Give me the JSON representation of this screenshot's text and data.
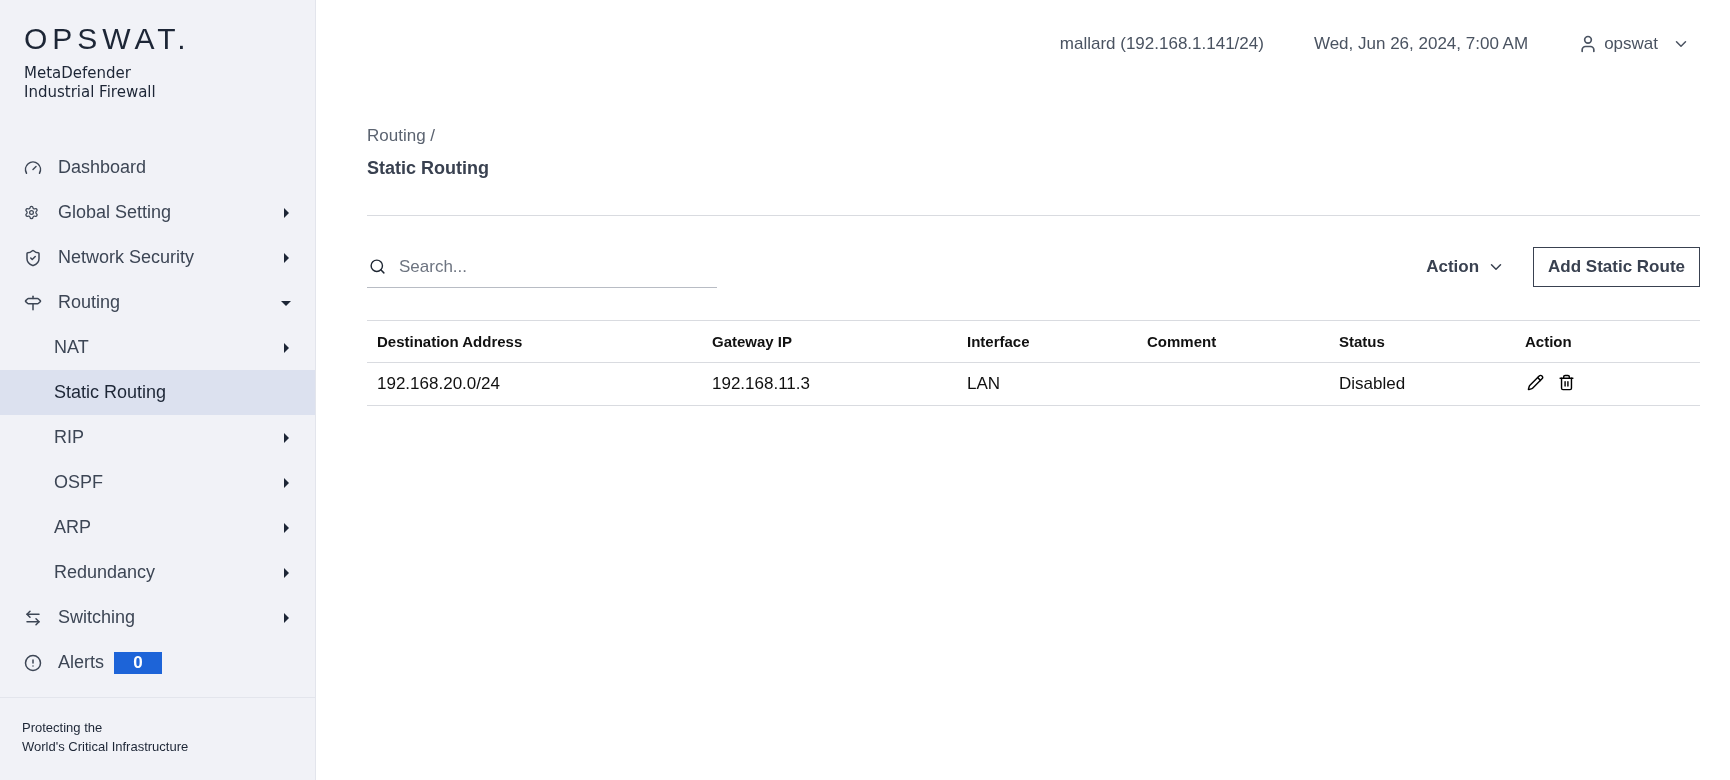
{
  "brand": {
    "logo": "OPSWAT.",
    "product": "MetaDefender",
    "subtitle": "Industrial Firewall"
  },
  "sidebar": {
    "items": [
      {
        "label": "Dashboard",
        "has_arrow": false,
        "selected": false
      },
      {
        "label": "Global Setting",
        "has_arrow": true,
        "selected": false
      },
      {
        "label": "Network Security",
        "has_arrow": true,
        "selected": false
      },
      {
        "label": "Routing",
        "has_arrow": true,
        "expanded": true,
        "selected": false,
        "children": [
          {
            "label": "NAT",
            "has_arrow": true,
            "selected": false
          },
          {
            "label": "Static Routing",
            "has_arrow": false,
            "selected": true
          },
          {
            "label": "RIP",
            "has_arrow": true,
            "selected": false
          },
          {
            "label": "OSPF",
            "has_arrow": true,
            "selected": false
          },
          {
            "label": "ARP",
            "has_arrow": true,
            "selected": false
          },
          {
            "label": "Redundancy",
            "has_arrow": true,
            "selected": false
          }
        ]
      },
      {
        "label": "Switching",
        "has_arrow": true,
        "selected": false
      },
      {
        "label": "Alerts",
        "has_arrow": false,
        "selected": false,
        "badge": "0"
      }
    ],
    "footer": [
      "Protecting the",
      "World's Critical Infrastructure"
    ]
  },
  "header": {
    "host": "mallard (192.168.1.141/24)",
    "datetime": "Wed, Jun 26, 2024, 7:00 AM",
    "user": "opswat"
  },
  "breadcrumb": {
    "parent": "Routing /",
    "title": "Static Routing"
  },
  "toolbar": {
    "search_placeholder": "Search...",
    "action_menu": "Action",
    "add_button": "Add Static Route"
  },
  "table": {
    "columns": [
      "Destination Address",
      "Gateway IP",
      "Interface",
      "Comment",
      "Status",
      "Action"
    ],
    "rows": [
      {
        "destination": "192.168.20.0/24",
        "gateway": "192.168.11.3",
        "interface": "LAN",
        "status": "Disabled"
      }
    ]
  }
}
